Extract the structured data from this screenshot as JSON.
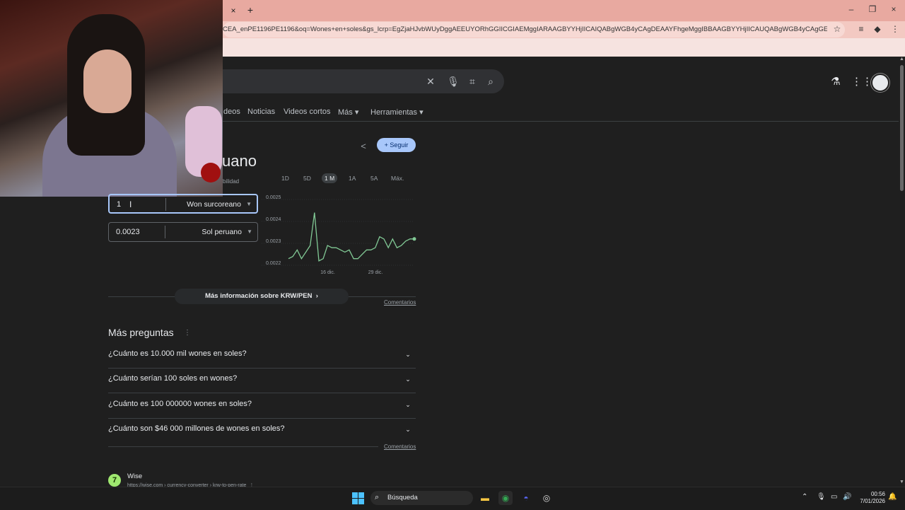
{
  "browser": {
    "url": "CEA_enPE1196PE1196&oq=Wones+en+soles&gs_lcrp=EgZjaHJvbWUyDggAEEUYORhGGIICGIAEMggIARAAGBYYHjIICAIQABgWGB4yCAgDEAAYFhgeMggIBBAAGBYYHjIICAUQABgWGB4yCAgGEAAYFhgeMg...",
    "tab_close": "×",
    "tab_new": "+",
    "minimize": "–",
    "maximize": "❐",
    "close": "×"
  },
  "nav": {
    "items": [
      "deos",
      "Noticias",
      "Videos cortos",
      "Más ▾",
      "Herramientas ▾"
    ]
  },
  "card": {
    "title_fragment": "uano",
    "subtitle_fragment": "bilidad",
    "follow_label": "+ Seguir",
    "ranges": [
      "1D",
      "5D",
      "1 M",
      "1A",
      "5A",
      "Máx."
    ],
    "active_range": "1 M",
    "from_value": "1",
    "from_currency": "Won surcoreano",
    "to_value": "0.0023",
    "to_currency": "Sol peruano",
    "more_info": "Más información sobre KRW/PEN",
    "comments": "Comentarios"
  },
  "chart_data": {
    "type": "line",
    "y_ticks": [
      "0.0025",
      "0.0024",
      "0.0023",
      "0.0022"
    ],
    "x_ticks": [
      "16 dic.",
      "29 dic."
    ],
    "ylim": [
      0.0022,
      0.0025
    ],
    "values": [
      0.00223,
      0.00224,
      0.00227,
      0.00223,
      0.00226,
      0.00229,
      0.00244,
      0.00222,
      0.00223,
      0.00229,
      0.00228,
      0.00228,
      0.00227,
      0.00226,
      0.00227,
      0.00223,
      0.00223,
      0.00225,
      0.00227,
      0.00227,
      0.00228,
      0.00233,
      0.00232,
      0.00228,
      0.00232,
      0.00228,
      0.00229,
      0.00231,
      0.00232,
      0.00232
    ],
    "color": "#81c995",
    "grid": true
  },
  "questions": {
    "title": "Más preguntas",
    "items": [
      "¿Cuánto es 10.000 mil wones en soles?",
      "¿Cuánto serían 100 soles en wones?",
      "¿Cuánto es 100 000000 wones en soles?",
      "¿Cuánto son $46 000 millones de wones en soles?"
    ],
    "comments": "Comentarios"
  },
  "result": {
    "site": "Wise",
    "url": "https://wise.com › currency-converter › krw-to-pen-rate",
    "logo_char": "7"
  },
  "taskbar": {
    "search_label": "Búsqueda",
    "time": "00:56",
    "date": "7/01/2026"
  }
}
